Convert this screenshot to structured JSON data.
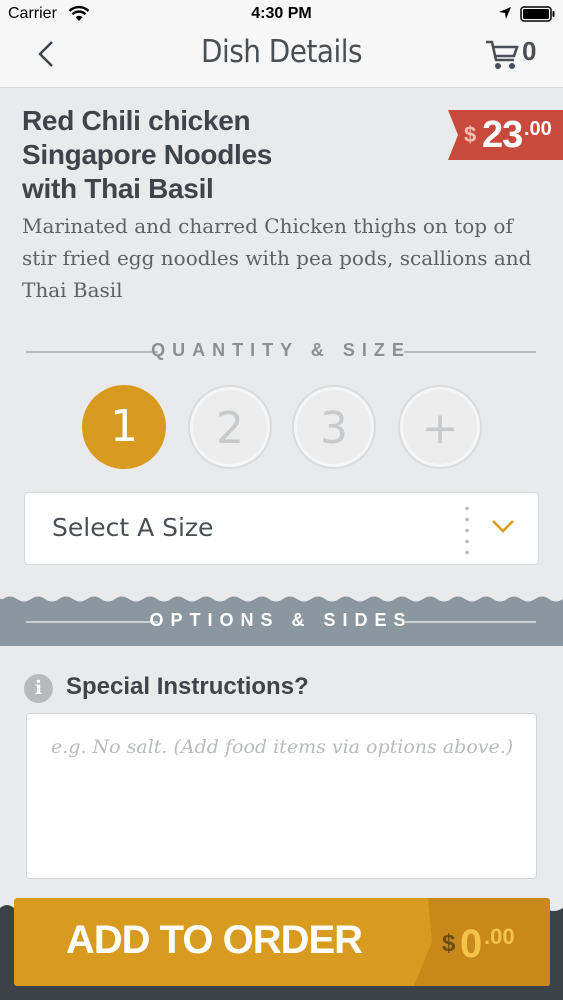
{
  "status_bar": {
    "carrier": "Carrier",
    "time": "4:30 PM"
  },
  "nav": {
    "title": "Dish Details",
    "cart_count": "0"
  },
  "dish": {
    "name_line1": "Red Chili chicken",
    "name_line2": "Singapore Noodles",
    "name_line3": "with Thai Basil",
    "price_currency": "$",
    "price_dollars": "23",
    "price_cents": ".00",
    "description": "Marinated and charred Chicken thighs on top of stir fried egg noodles with pea pods, scallions and Thai Basil"
  },
  "quantity_section": {
    "label": "QUANTITY & SIZE",
    "options": [
      "1",
      "2",
      "3",
      "+"
    ],
    "selected": "1",
    "size_placeholder": "Select A Size"
  },
  "options_section": {
    "label": "OPTIONS & SIDES"
  },
  "special_instructions": {
    "title": "Special Instructions?",
    "placeholder": "e.g. No salt. (Add food items via options above.)"
  },
  "add_to_order": {
    "label": "ADD TO ORDER",
    "total_currency": "$",
    "total_dollars": "0",
    "total_cents": ".00"
  },
  "colors": {
    "accent": "#d89a1f",
    "price_tag": "#c84a3d",
    "options_band": "#8b979f",
    "bottom_band": "#3d4249"
  }
}
